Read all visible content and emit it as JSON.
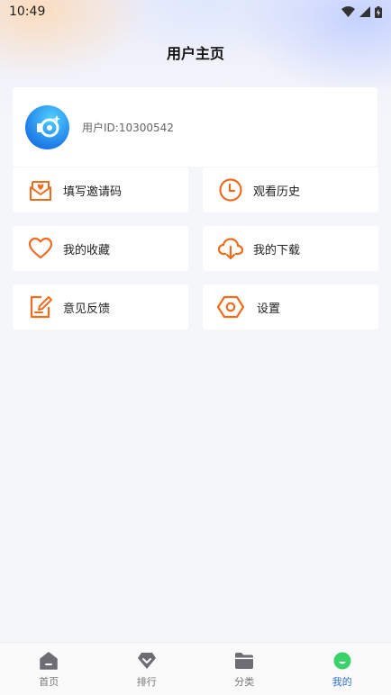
{
  "status_bar": {
    "time": "10:49"
  },
  "header": {
    "title": "用户主页"
  },
  "user": {
    "id_text": "用户ID:10300542"
  },
  "menu": {
    "invite": "填写邀请码",
    "history": "观看历史",
    "favorites": "我的收藏",
    "downloads": "我的下载",
    "feedback": "意见反馈",
    "settings": "设置"
  },
  "tabbar": {
    "items": [
      {
        "label": "首页",
        "icon": "home-icon"
      },
      {
        "label": "排行",
        "icon": "ranking-icon"
      },
      {
        "label": "分类",
        "icon": "folder-icon"
      },
      {
        "label": "我的",
        "icon": "profile-icon"
      }
    ],
    "active_index": 3
  },
  "colors": {
    "accent_orange": "#f26b1d",
    "active_tab": "#2f6fd6",
    "profile_green": "#3ad36b",
    "avatar_blue": "#1e7be8"
  }
}
